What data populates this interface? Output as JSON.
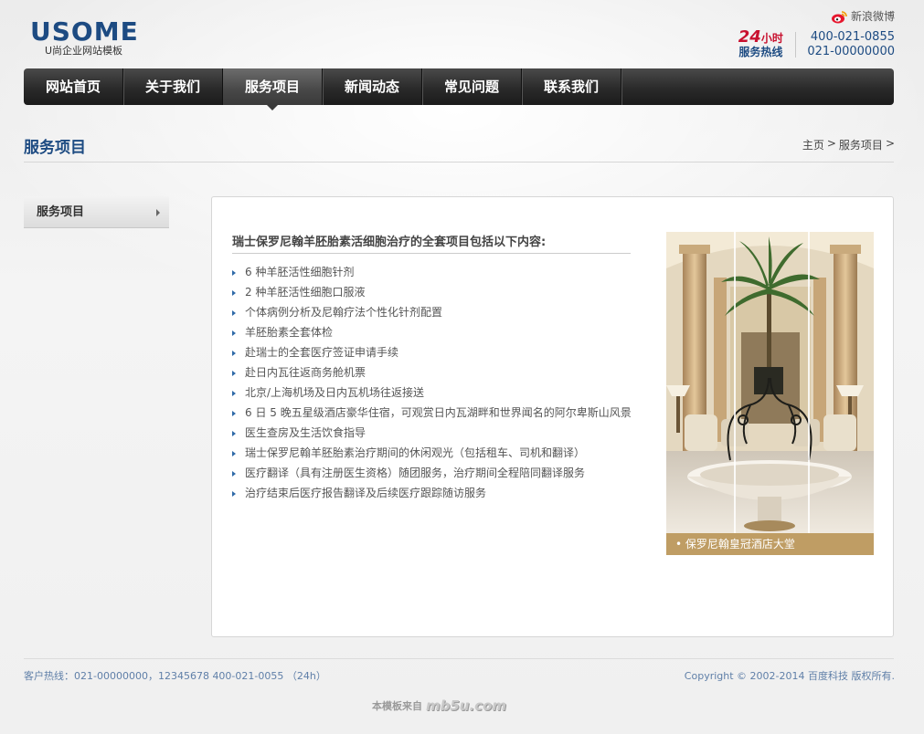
{
  "header": {
    "logo_main": "USOME",
    "logo_sub": "U尚企业网站模板",
    "weibo_label": "新浪微博",
    "hotline": {
      "hours": "24",
      "hours_unit": "小时",
      "label": "服务热线",
      "phone1": "400-021-0855",
      "phone2": "021-00000000"
    }
  },
  "nav": {
    "items": [
      {
        "label": "网站首页"
      },
      {
        "label": "关于我们"
      },
      {
        "label": "服务项目"
      },
      {
        "label": "新闻动态"
      },
      {
        "label": "常见问题"
      },
      {
        "label": "联系我们"
      }
    ]
  },
  "page": {
    "title": "服务项目",
    "breadcrumb": {
      "home": "主页",
      "sep1": ">",
      "current": "服务项目",
      "sep2": ">"
    }
  },
  "sidebar": {
    "items": [
      {
        "label": "服务项目"
      }
    ]
  },
  "content": {
    "intro": "瑞士保罗尼翰羊胚胎素活细胞治疗的全套项目包括以下内容:",
    "items": [
      "6 种羊胚活性细胞针剂",
      "2 种羊胚活性细胞口服液",
      "个体病例分析及尼翰疗法个性化针剂配置",
      "羊胚胎素全套体检",
      "赴瑞士的全套医疗签证申请手续",
      "赴日内瓦往返商务舱机票",
      "北京/上海机场及日内瓦机场往返接送",
      "6 日 5 晚五星级酒店豪华住宿，可观赏日内瓦湖畔和世界闻名的阿尔卑斯山风景",
      "医生查房及生活饮食指导",
      "瑞士保罗尼翰羊胚胎素治疗期间的休闲观光（包括租车、司机和翻译）",
      "医疗翻译（具有注册医生资格）随团服务，治疗期间全程陪同翻译服务",
      "治疗结束后医疗报告翻译及后续医疗跟踪随访服务"
    ],
    "photo_caption": "保罗尼翰皇冠酒店大堂"
  },
  "footer": {
    "left": "客户热线：021-00000000，12345678 400-021-0055 （24h）",
    "right": "Copyright © 2002-2014 百度科技 版权所有.",
    "credit_text": "本模板来自",
    "credit_logo": "mb5u.com"
  },
  "colors": {
    "brand": "#1d4b82",
    "accent_red": "#c8102e",
    "caption_bg": "#bf9d64",
    "nav_bg": "#2a2a2a"
  }
}
